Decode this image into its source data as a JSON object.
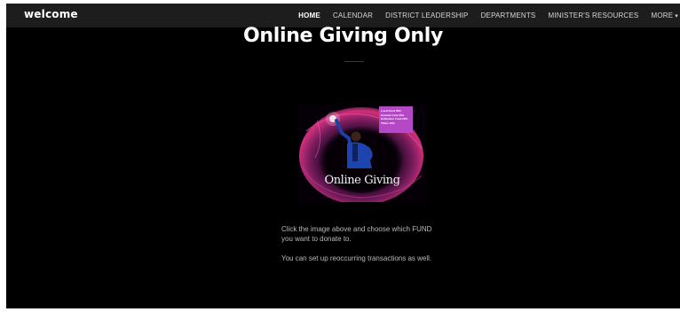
{
  "navbar": {
    "brand": "welcome",
    "items": [
      {
        "label": "HOME",
        "active": true
      },
      {
        "label": "CALENDAR",
        "active": false
      },
      {
        "label": "DISTRICT LEADERSHIP",
        "active": false
      },
      {
        "label": "DEPARTMENTS",
        "active": false
      },
      {
        "label": "MINISTER'S RESOURCES",
        "active": false
      },
      {
        "label": "MORE",
        "active": false
      }
    ],
    "more_icon": "chevron-down-icon"
  },
  "main": {
    "title": "Online Giving Only",
    "image": {
      "caption": "Online Giving",
      "fund_lines": [
        "Local Fund 35%",
        "General Fund 30%",
        "Ordination Fund 20%",
        "Tithes 10%"
      ],
      "accent_color": "#b548c6"
    },
    "instructions": [
      "Click the image above and choose which FUND you want to donate to.",
      "You can set up reoccurring transactions as well."
    ]
  },
  "colors": {
    "background": "#000000",
    "navbar": "#1d1d1d",
    "text": "#b9b9b9",
    "title": "#ffffff"
  }
}
